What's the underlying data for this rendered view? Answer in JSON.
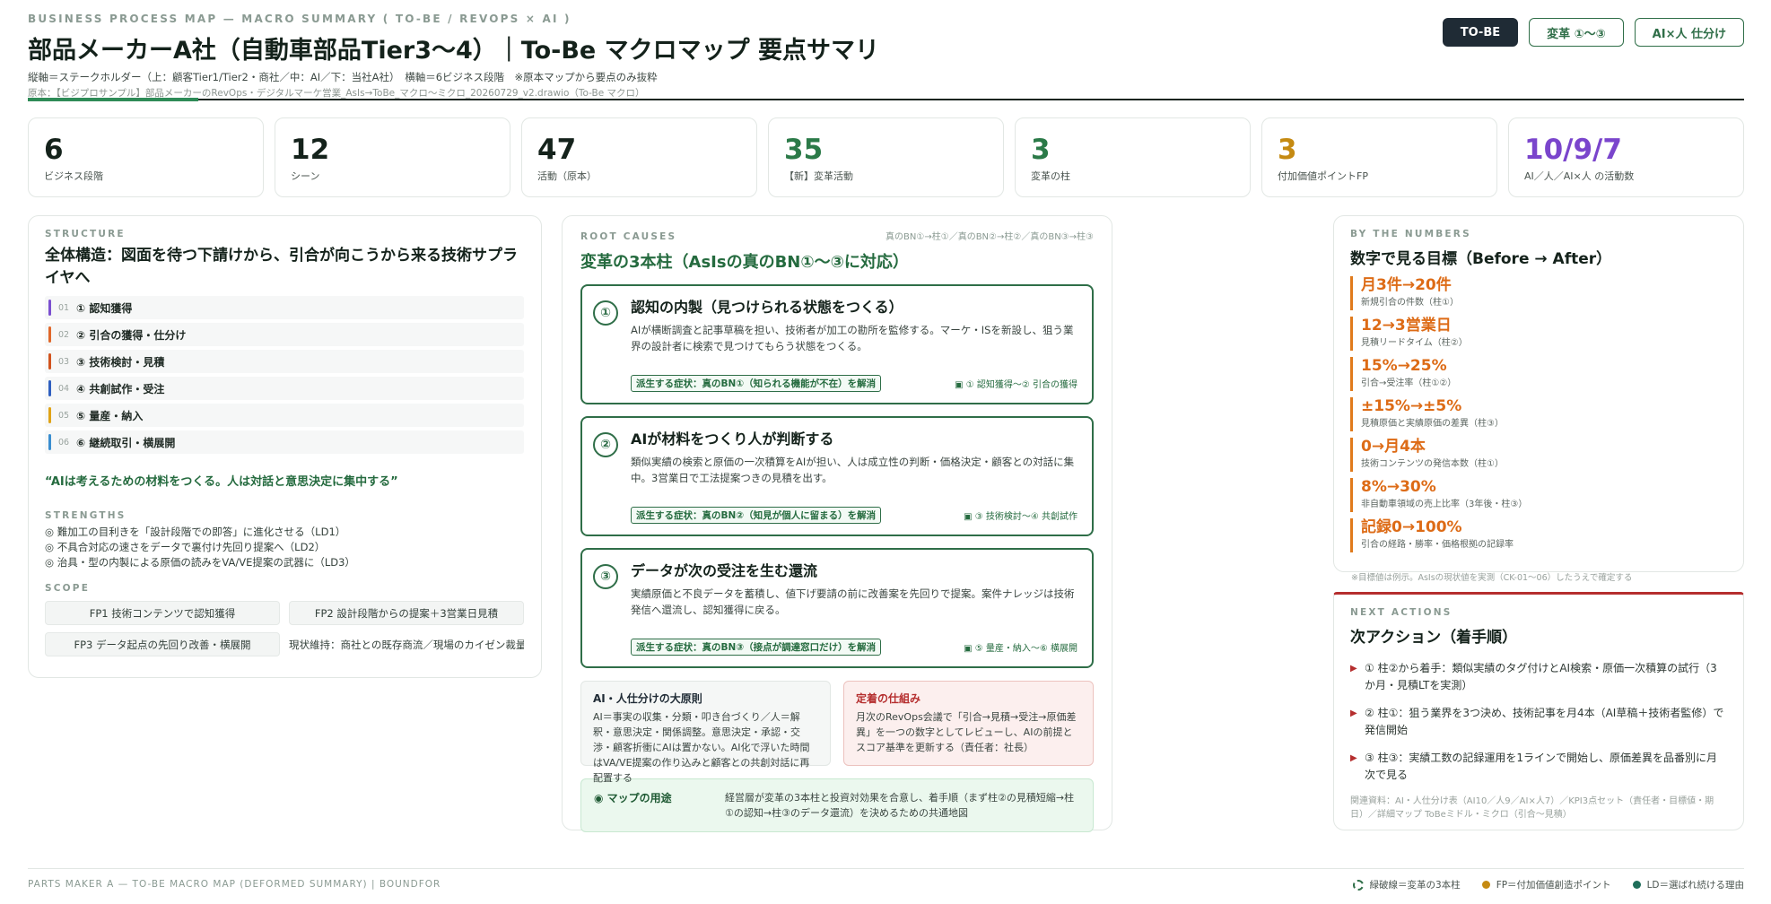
{
  "header": {
    "kicker": "BUSINESS PROCESS MAP — MACRO SUMMARY ( TO-BE / REVOPS × AI )",
    "title": "部品メーカーA社（自動車部品Tier3〜4）｜To-Be マクロマップ 要点サマリ",
    "subtitle": "縦軸＝ステークホルダー（上：顧客Tier1/Tier2・商社／中：AI／下：当社A社）　横軸＝6ビジネス段階　※原本マップから要点のみ抜粋",
    "source": "原本：【ビジプロサンプル】部品メーカーのRevOps・デジタルマーケ営業_AsIs→ToBe_マクロ〜ミクロ_20260729_v2.drawio（To-Be マクロ）",
    "buttons": [
      "TO-BE",
      "変革 ①〜③",
      "AI×人 仕分け"
    ]
  },
  "kpis": [
    {
      "value": "6",
      "label": "ビジネス段階",
      "color": "#14221b"
    },
    {
      "value": "12",
      "label": "シーン",
      "color": "#14221b"
    },
    {
      "value": "47",
      "label": "活動（原本）",
      "color": "#14221b"
    },
    {
      "value": "35",
      "label": "【新】変革活動",
      "color": "#2b7a48"
    },
    {
      "value": "3",
      "label": "変革の柱",
      "color": "#2b7a48"
    },
    {
      "value": "3",
      "label": "付加価値ポイントFP",
      "color": "#c58a12"
    },
    {
      "value": "10/9/7",
      "label": "AI／人／AI×人 の活動数",
      "color": "#7a45cc"
    }
  ],
  "structure": {
    "kicker": "STRUCTURE",
    "title": "全体構造：図面を待つ下請けから、引合が向こうから来る技術サプライヤへ",
    "stages": [
      {
        "num": "01",
        "label": "① 認知獲得",
        "color": "#7b4fd0"
      },
      {
        "num": "02",
        "label": "② 引合の獲得・仕分け",
        "color": "#e0672a"
      },
      {
        "num": "03",
        "label": "③ 技術検討・見積",
        "color": "#d1531e"
      },
      {
        "num": "04",
        "label": "④ 共創試作・受注",
        "color": "#2f5fc0"
      },
      {
        "num": "05",
        "label": "⑤ 量産・納入",
        "color": "#e0a317"
      },
      {
        "num": "06",
        "label": "⑥ 継続取引・横展開",
        "color": "#3a8ed0"
      }
    ],
    "quote": "“AIは考えるための材料をつくる。人は対話と意思決定に集中する”",
    "strengths_k": "STRENGTHS",
    "strengths": [
      "◎ 難加工の目利きを「設計段階での即答」に進化させる（LD1）",
      "◎ 不具合対応の速さをデータで裏付け先回り提案へ（LD2）",
      "◎ 治具・型の内製による原価の読みをVA/VE提案の武器に（LD3）"
    ],
    "scope_k": "SCOPE",
    "scope": [
      "FP1 技術コンテンツで認知獲得",
      "FP2 設計段階からの提案＋3営業日見積",
      "FP3 データ起点の先回り改善・横展開"
    ],
    "scope_note": "現状維持：商社との既存商流／現場のカイゼン裁量"
  },
  "root": {
    "kicker": "ROOT CAUSES",
    "note": "真のBN①→柱①／真のBN②→柱②／真のBN③→柱③",
    "title": "変革の3本柱（AsIsの真のBN①〜③に対応）",
    "pillars": [
      {
        "num": "①",
        "title": "認知の内製（見つけられる状態をつくる）",
        "desc": "AIが横断調査と記事草稿を担い、技術者が加工の勘所を監修する。マーケ・ISを新設し、狙う業界の設計者に検索で見つけてもらう状態をつくる。",
        "tag": "派生する症状：真のBN①（知られる機能が不在）を解消",
        "fp": "▣ ① 認知獲得〜② 引合の獲得"
      },
      {
        "num": "②",
        "title": "AIが材料をつくり人が判断する",
        "desc": "類似実績の検索と原価の一次積算をAIが担い、人は成立性の判断・価格決定・顧客との対話に集中。3営業日で工法提案つきの見積を出す。",
        "tag": "派生する症状：真のBN②（知見が個人に留まる）を解消",
        "fp": "▣ ③ 技術検討〜④ 共創試作"
      },
      {
        "num": "③",
        "title": "データが次の受注を生む還流",
        "desc": "実績原価と不良データを蓄積し、値下げ要請の前に改善案を先回りで提案。案件ナレッジは技術発信へ還流し、認知獲得に戻る。",
        "tag": "派生する症状：真のBN③（接点が調達窓口だけ）を解消",
        "fp": "▣ ⑤ 量産・納入〜⑥ 横展開"
      }
    ],
    "principle_title": "AI・人仕分けの大原則",
    "principle_desc": "AI＝事実の収集・分類・叩き台づくり／人＝解釈・意思決定・関係調整。意思決定・承認・交渉・顧客折衝にAIは置かない。AI化で浮いた時間はVA/VE提案の作り込みと顧客との共創対話に再配置する",
    "anchor_title": "定着の仕組み",
    "anchor_desc": "月次のRevOps会議で「引合→見積→受注→原価差異」を一つの数字としてレビューし、AIの前提とスコア基準を更新する（責任者：社長）",
    "usage_title": "◉ マップの用途",
    "usage_desc": "経営層が変革の3本柱と投資対効果を合意し、着手順（まず柱②の見積短縮→柱①の認知→柱③のデータ還流）を決めるための共通地図"
  },
  "numbers": {
    "kicker": "BY THE NUMBERS",
    "title": "数字で見る目標（Before → After）",
    "goals": [
      {
        "value": "月3件→20件",
        "label": "新規引合の件数（柱①）"
      },
      {
        "value": "12→3営業日",
        "label": "見積リードタイム（柱②）"
      },
      {
        "value": "15%→25%",
        "label": "引合→受注率（柱①②）"
      },
      {
        "value": "±15%→±5%",
        "label": "見積原価と実績原価の差異（柱③）"
      },
      {
        "value": "0→月4本",
        "label": "技術コンテンツの発信本数（柱①）"
      },
      {
        "value": "8%→30%",
        "label": "非自動車領域の売上比率（3年後・柱③）"
      },
      {
        "value": "記録0→100%",
        "label": "引合の経路・勝率・価格根拠の記録率"
      }
    ],
    "foot": "※目標値は例示。AsIsの現状値を実測（CK-01〜06）したうえで確定する"
  },
  "next": {
    "kicker": "NEXT ACTIONS",
    "title": "次アクション（着手順）",
    "actions": [
      "① 柱②から着手：類似実績のタグ付けとAI検索・原価一次積算の試行（3か月・見積LTを実測）",
      "② 柱①：狙う業界を3つ決め、技術記事を月4本（AI草稿＋技術者監修）で発信開始",
      "③ 柱③：実績工数の記録運用を1ラインで開始し、原価差異を品番別に月次で見る"
    ],
    "related": "関連資料：AI・人仕分け表（AI10／人9／AI×人7）／KPI3点セット（責任者・目標値・期日）／詳細マップ ToBeミドル・ミクロ（引合〜見積）"
  },
  "footer": {
    "left": "PARTS MAKER A — TO-BE MACRO MAP (DEFORMED SUMMARY) | BOUNDFOR",
    "legend": [
      {
        "label": "緑破線＝変革の3本柱",
        "color": "#2f6e48"
      },
      {
        "label": "FP＝付加価値創造ポイント",
        "color": "#c58a12"
      },
      {
        "label": "LD＝選ばれ続ける理由",
        "color": "#1f6e5a"
      }
    ]
  }
}
